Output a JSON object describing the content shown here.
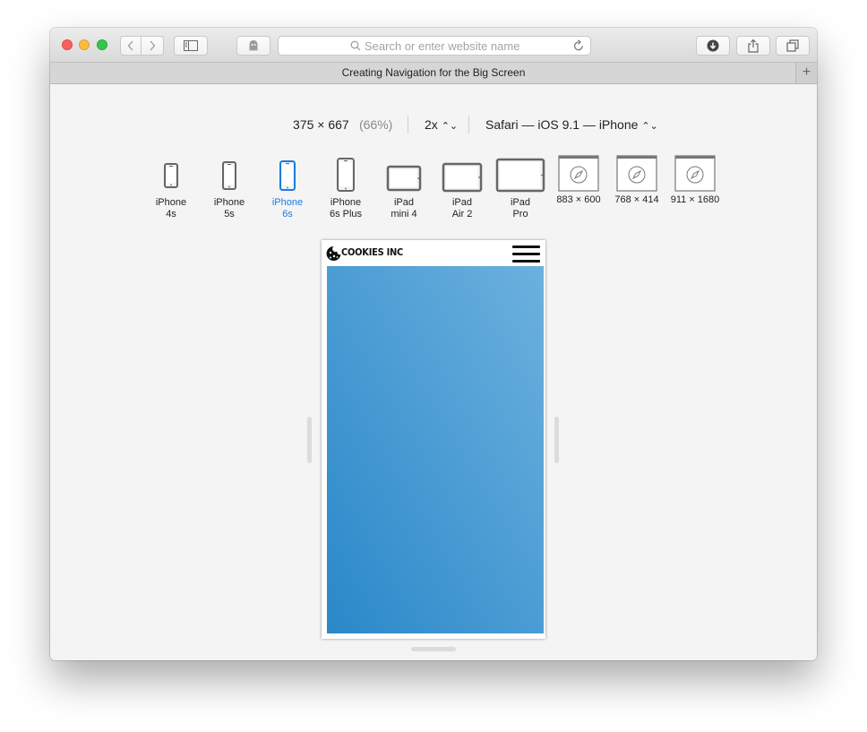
{
  "browser": {
    "address_placeholder": "Search or enter website name",
    "tab_title": "Creating Navigation for the Big Screen",
    "new_tab_symbol": "+"
  },
  "responsive_bar": {
    "size": "375 × 667",
    "zoom": "(66%)",
    "scale": "2x",
    "user_agent": "Safari — iOS 9.1 — iPhone"
  },
  "devices": [
    {
      "line1": "iPhone",
      "line2": "4s"
    },
    {
      "line1": "iPhone",
      "line2": "5s"
    },
    {
      "line1": "iPhone",
      "line2": "6s"
    },
    {
      "line1": "iPhone",
      "line2": "6s Plus"
    },
    {
      "line1": "iPad",
      "line2": "mini 4"
    },
    {
      "line1": "iPad",
      "line2": "Air 2"
    },
    {
      "line1": "iPad",
      "line2": "Pro"
    },
    {
      "line1": "883 × 600",
      "line2": ""
    },
    {
      "line1": "768 × 414",
      "line2": ""
    },
    {
      "line1": "911 × 1680",
      "line2": ""
    }
  ],
  "selected_device": "iPhone 6s",
  "preview": {
    "logo_text": "COOKIES INC",
    "hero_gradient": [
      "#2a88c9",
      "#6cb1de"
    ]
  },
  "colors": {
    "accent": "#1a7ae6",
    "close": "#fc605c",
    "minimize": "#fdbc40",
    "maximize": "#34c84a"
  }
}
